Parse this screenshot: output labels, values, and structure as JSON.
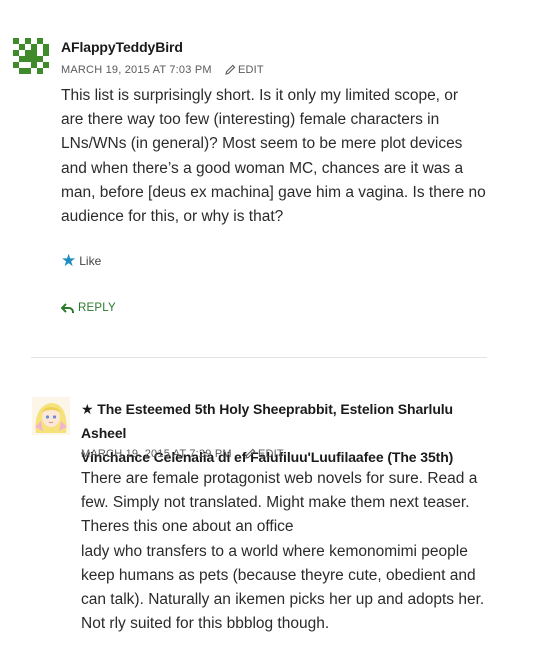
{
  "comments": [
    {
      "author": "AFlappyTeddyBird",
      "date": "MARCH 19, 2015 AT 7:03 PM",
      "edit_label": "EDIT",
      "lines": [
        "This list is surprisingly short. Is it only my limited scope, or",
        "are there way too few (interesting) female characters in",
        "LNs/WNs (in general)? Most seem to be mere plot devices",
        "and when there’s a good woman MC, chances are it was a",
        "man, before [deus ex machina] gave him a vagina. Is there no",
        "audience for this, or why is that?"
      ],
      "like_label": "Like",
      "reply_label": "REPLY"
    },
    {
      "author_line1": "★ The Esteemed 5th Holy Sheeprabbit, Estelion Sharlulu Asheel",
      "author_line2": "Vinchance Celenalia di ef Falufiluu'Luufilaafee (The 35th)",
      "date": "MARCH 19, 2015 AT 7:29 PM",
      "edit_label": "EDIT",
      "lines": [
        "There are female protagonist web novels for sure. Read a",
        "few. Simply not translated. Might make them next teaser.",
        "Theres this one about an office",
        "lady who transfers to a world where kemonomimi people",
        "keep humans as pets (because theyre cute, obedient and",
        "can talk). Naturally an ikemen picks her up and adopts her.",
        "Not rly suited for this bbblog though."
      ]
    }
  ],
  "colors": {
    "accent_like": "#1e8cbe",
    "reply_green": "#2b7a2b",
    "identicon_green": "#3f8a2b"
  }
}
